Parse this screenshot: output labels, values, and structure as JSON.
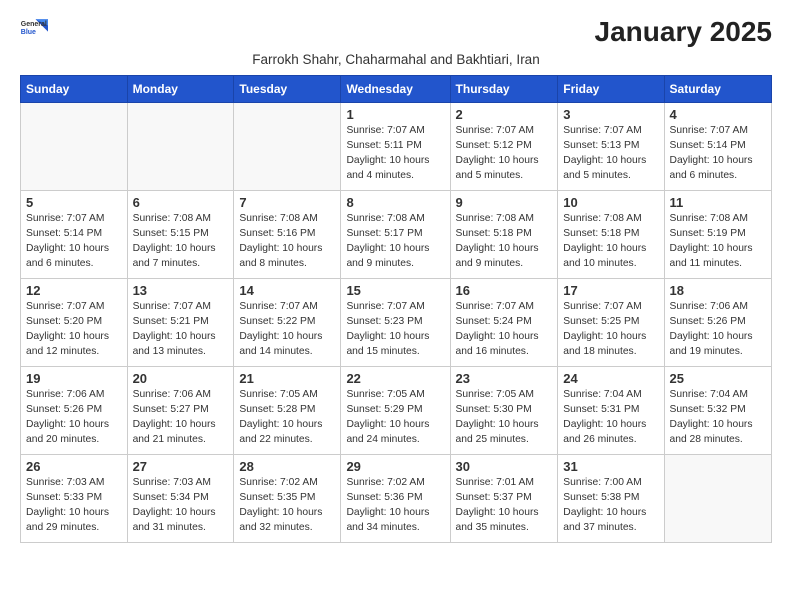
{
  "logo": {
    "general": "General",
    "blue": "Blue"
  },
  "title": "January 2025",
  "subtitle": "Farrokh Shahr, Chaharmahal and Bakhtiari, Iran",
  "days_of_week": [
    "Sunday",
    "Monday",
    "Tuesday",
    "Wednesday",
    "Thursday",
    "Friday",
    "Saturday"
  ],
  "weeks": [
    [
      {
        "day": "",
        "info": ""
      },
      {
        "day": "",
        "info": ""
      },
      {
        "day": "",
        "info": ""
      },
      {
        "day": "1",
        "info": "Sunrise: 7:07 AM\nSunset: 5:11 PM\nDaylight: 10 hours and 4 minutes."
      },
      {
        "day": "2",
        "info": "Sunrise: 7:07 AM\nSunset: 5:12 PM\nDaylight: 10 hours and 5 minutes."
      },
      {
        "day": "3",
        "info": "Sunrise: 7:07 AM\nSunset: 5:13 PM\nDaylight: 10 hours and 5 minutes."
      },
      {
        "day": "4",
        "info": "Sunrise: 7:07 AM\nSunset: 5:14 PM\nDaylight: 10 hours and 6 minutes."
      }
    ],
    [
      {
        "day": "5",
        "info": "Sunrise: 7:07 AM\nSunset: 5:14 PM\nDaylight: 10 hours and 6 minutes."
      },
      {
        "day": "6",
        "info": "Sunrise: 7:08 AM\nSunset: 5:15 PM\nDaylight: 10 hours and 7 minutes."
      },
      {
        "day": "7",
        "info": "Sunrise: 7:08 AM\nSunset: 5:16 PM\nDaylight: 10 hours and 8 minutes."
      },
      {
        "day": "8",
        "info": "Sunrise: 7:08 AM\nSunset: 5:17 PM\nDaylight: 10 hours and 9 minutes."
      },
      {
        "day": "9",
        "info": "Sunrise: 7:08 AM\nSunset: 5:18 PM\nDaylight: 10 hours and 9 minutes."
      },
      {
        "day": "10",
        "info": "Sunrise: 7:08 AM\nSunset: 5:18 PM\nDaylight: 10 hours and 10 minutes."
      },
      {
        "day": "11",
        "info": "Sunrise: 7:08 AM\nSunset: 5:19 PM\nDaylight: 10 hours and 11 minutes."
      }
    ],
    [
      {
        "day": "12",
        "info": "Sunrise: 7:07 AM\nSunset: 5:20 PM\nDaylight: 10 hours and 12 minutes."
      },
      {
        "day": "13",
        "info": "Sunrise: 7:07 AM\nSunset: 5:21 PM\nDaylight: 10 hours and 13 minutes."
      },
      {
        "day": "14",
        "info": "Sunrise: 7:07 AM\nSunset: 5:22 PM\nDaylight: 10 hours and 14 minutes."
      },
      {
        "day": "15",
        "info": "Sunrise: 7:07 AM\nSunset: 5:23 PM\nDaylight: 10 hours and 15 minutes."
      },
      {
        "day": "16",
        "info": "Sunrise: 7:07 AM\nSunset: 5:24 PM\nDaylight: 10 hours and 16 minutes."
      },
      {
        "day": "17",
        "info": "Sunrise: 7:07 AM\nSunset: 5:25 PM\nDaylight: 10 hours and 18 minutes."
      },
      {
        "day": "18",
        "info": "Sunrise: 7:06 AM\nSunset: 5:26 PM\nDaylight: 10 hours and 19 minutes."
      }
    ],
    [
      {
        "day": "19",
        "info": "Sunrise: 7:06 AM\nSunset: 5:26 PM\nDaylight: 10 hours and 20 minutes."
      },
      {
        "day": "20",
        "info": "Sunrise: 7:06 AM\nSunset: 5:27 PM\nDaylight: 10 hours and 21 minutes."
      },
      {
        "day": "21",
        "info": "Sunrise: 7:05 AM\nSunset: 5:28 PM\nDaylight: 10 hours and 22 minutes."
      },
      {
        "day": "22",
        "info": "Sunrise: 7:05 AM\nSunset: 5:29 PM\nDaylight: 10 hours and 24 minutes."
      },
      {
        "day": "23",
        "info": "Sunrise: 7:05 AM\nSunset: 5:30 PM\nDaylight: 10 hours and 25 minutes."
      },
      {
        "day": "24",
        "info": "Sunrise: 7:04 AM\nSunset: 5:31 PM\nDaylight: 10 hours and 26 minutes."
      },
      {
        "day": "25",
        "info": "Sunrise: 7:04 AM\nSunset: 5:32 PM\nDaylight: 10 hours and 28 minutes."
      }
    ],
    [
      {
        "day": "26",
        "info": "Sunrise: 7:03 AM\nSunset: 5:33 PM\nDaylight: 10 hours and 29 minutes."
      },
      {
        "day": "27",
        "info": "Sunrise: 7:03 AM\nSunset: 5:34 PM\nDaylight: 10 hours and 31 minutes."
      },
      {
        "day": "28",
        "info": "Sunrise: 7:02 AM\nSunset: 5:35 PM\nDaylight: 10 hours and 32 minutes."
      },
      {
        "day": "29",
        "info": "Sunrise: 7:02 AM\nSunset: 5:36 PM\nDaylight: 10 hours and 34 minutes."
      },
      {
        "day": "30",
        "info": "Sunrise: 7:01 AM\nSunset: 5:37 PM\nDaylight: 10 hours and 35 minutes."
      },
      {
        "day": "31",
        "info": "Sunrise: 7:00 AM\nSunset: 5:38 PM\nDaylight: 10 hours and 37 minutes."
      },
      {
        "day": "",
        "info": ""
      }
    ]
  ]
}
